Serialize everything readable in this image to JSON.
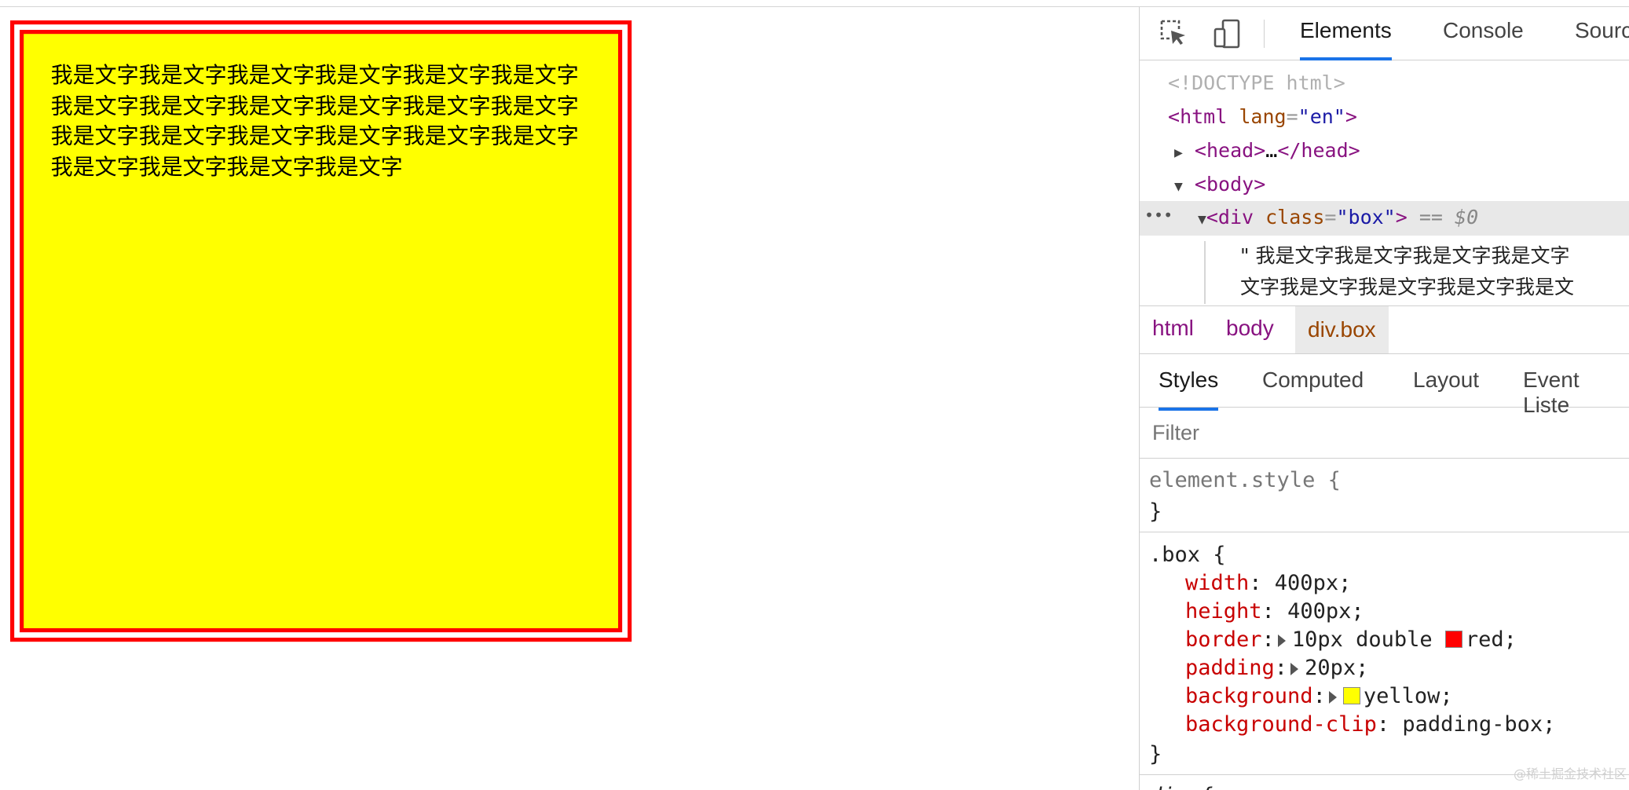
{
  "page": {
    "box_text": "我是文字我是文字我是文字我是文字我是文字我是文字我是文字我是文字我是文字我是文字我是文字我是文字我是文字我是文字我是文字我是文字我是文字我是文字我是文字我是文字我是文字我是文字",
    "colors": {
      "border": "#ff0000",
      "background": "#ffff00"
    }
  },
  "devtools": {
    "toolbar": {
      "tabs": [
        "Elements",
        "Console",
        "Sourc"
      ],
      "active_tab": "Elements",
      "icons": [
        "inspect-element-icon",
        "device-toolbar-icon"
      ]
    },
    "dom": {
      "doctype": "<!DOCTYPE html>",
      "html_tag": "html",
      "html_attr_name": "lang",
      "html_attr_value": "en",
      "head_tag": "head",
      "head_ellipsis": "…",
      "body_tag": "body",
      "div_tag": "div",
      "div_attr_name": "class",
      "div_attr_value": "box",
      "selected_marker": "== $0",
      "row_menu": "•••",
      "text_line_1": "\" 我是文字我是文字我是文字我是文字",
      "text_line_2": "文字我是文字我是文字我是文字我是文"
    },
    "breadcrumb": [
      "html",
      "body",
      "div.box"
    ],
    "sub_tabs": [
      "Styles",
      "Computed",
      "Layout",
      "Event Liste"
    ],
    "active_sub_tab": "Styles",
    "filter_placeholder": "Filter",
    "styles": {
      "element_style_selector": "element.style {",
      "element_style_close": "}",
      "box_selector": ".box {",
      "props": [
        {
          "name": "width",
          "value": "400px;"
        },
        {
          "name": "height",
          "value": "400px;"
        },
        {
          "name": "border",
          "value": "10px double",
          "swatch": "#ff0000",
          "swatch_value": "red;"
        },
        {
          "name": "padding",
          "value": "20px;"
        },
        {
          "name": "background",
          "value": "",
          "swatch": "#ffff00",
          "swatch_value": "yellow;"
        },
        {
          "name": "background-clip",
          "value": "padding-box;"
        }
      ],
      "box_close": "}",
      "next_selector_partial": "div {"
    },
    "watermark": "@稀土掘金技术社区"
  }
}
